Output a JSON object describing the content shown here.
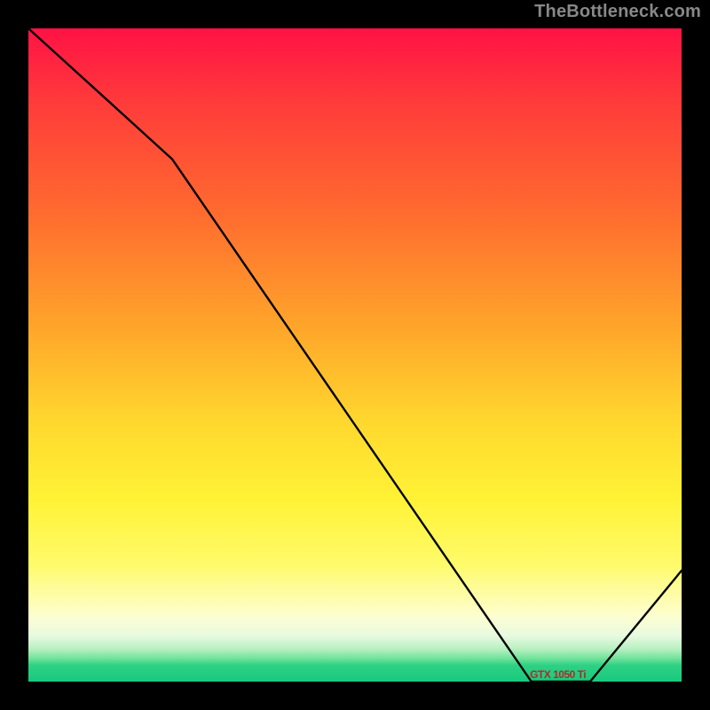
{
  "watermark": "TheBottleneck.com",
  "chart_data": {
    "type": "line",
    "title": "",
    "xlabel": "",
    "ylabel": "",
    "xlim": [
      0,
      100
    ],
    "ylim": [
      0,
      100
    ],
    "series": [
      {
        "name": "bottleneck-curve",
        "x": [
          0,
          22,
          77,
          86,
          100
        ],
        "values": [
          100,
          80,
          0,
          0,
          17
        ]
      }
    ],
    "annotations": [
      {
        "name": "target-range",
        "x": 81.5,
        "y": 1.5,
        "text": "GTX 1050 Ti"
      }
    ],
    "background": "heat-gradient-green-to-red"
  }
}
